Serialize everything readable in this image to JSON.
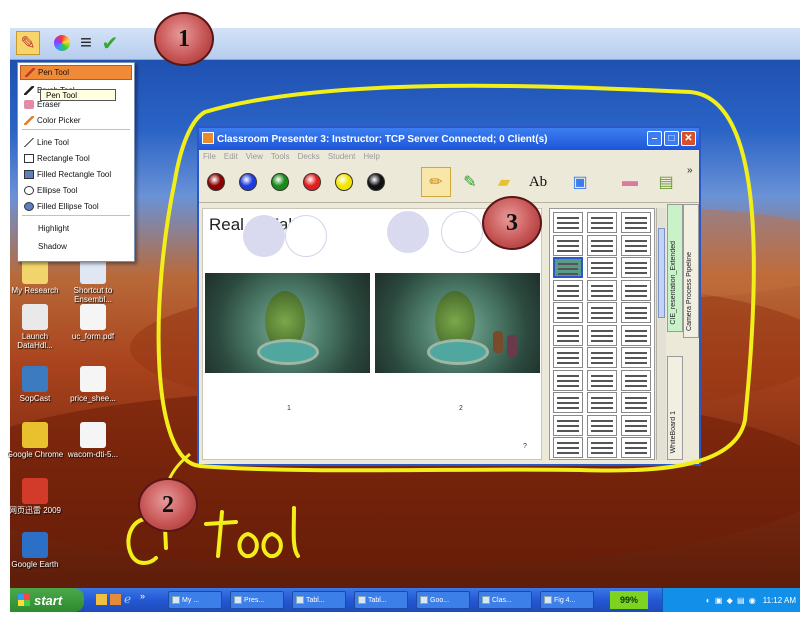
{
  "ink_toolbar": {
    "buttons": [
      {
        "icon": "pen-icon",
        "active": true
      },
      {
        "icon": "color-wheel-icon",
        "active": false
      },
      {
        "icon": "line-weight-icon",
        "active": false
      },
      {
        "icon": "checkmark-icon",
        "active": false
      }
    ]
  },
  "tool_menu": {
    "items": [
      {
        "label": "Pen Tool",
        "selected": true,
        "icon": "pen-icon"
      },
      {
        "label": "Brush Tool",
        "selected": false,
        "icon": "brush-icon"
      },
      {
        "label": "Eraser",
        "selected": false,
        "icon": "eraser-icon"
      },
      {
        "label": "Color Picker",
        "selected": false,
        "icon": "color-picker-icon"
      },
      {
        "label": "Line Tool",
        "selected": false,
        "icon": "line-icon"
      },
      {
        "label": "Rectangle Tool",
        "selected": false,
        "icon": "rectangle-icon"
      },
      {
        "label": "Filled Rectangle Tool",
        "selected": false,
        "icon": "filled-rectangle-icon"
      },
      {
        "label": "Ellipse Tool",
        "selected": false,
        "icon": "ellipse-icon"
      },
      {
        "label": "Filled Ellipse Tool",
        "selected": false,
        "icon": "filled-ellipse-icon"
      },
      {
        "label": "Highlight",
        "selected": false,
        "icon": ""
      },
      {
        "label": "Shadow",
        "selected": false,
        "icon": ""
      }
    ],
    "tooltip": "Pen Tool"
  },
  "desktop_icons": [
    {
      "label": "My Research",
      "icon": "folder-icon"
    },
    {
      "label": "Shortcut to Ensembl...",
      "icon": "shortcut-icon"
    },
    {
      "label": "Launch DataHdl...",
      "icon": "doc-icon"
    },
    {
      "label": "uc_form.pdf",
      "icon": "pdf-icon"
    },
    {
      "label": "SopCast",
      "icon": "sopcast-icon"
    },
    {
      "label": "price_shee...",
      "icon": "pdf-icon"
    },
    {
      "label": "Google Chrome",
      "icon": "chrome-icon"
    },
    {
      "label": "wacom-dti-5...",
      "icon": "pdf-icon"
    },
    {
      "label": "网页迅雷 2009",
      "icon": "thunder-icon"
    },
    {
      "label": "Google Earth",
      "icon": "earth-icon"
    }
  ],
  "cp_window": {
    "title": "Classroom Presenter 3: Instructor; TCP Server Connected; 0 Client(s)",
    "menu": [
      "File",
      "Edit",
      "View",
      "Tools",
      "Decks",
      "Student",
      "Help"
    ],
    "pen_colors": [
      "#8b0000",
      "#1e3cdc",
      "#1a8a1a",
      "#e01e1e",
      "#f2e600",
      "#111111"
    ],
    "text_tool_label": "Ab",
    "overflow_label": "»",
    "slide": {
      "title": "Real or Fake?",
      "labels": [
        "1",
        "2"
      ],
      "corner_mark": "?"
    },
    "deck_tabs": [
      "CIE_resentation_Extended",
      "Camera Process Pipeline",
      "WhiteBoard 1"
    ]
  },
  "callouts": [
    "1",
    "2",
    "3"
  ],
  "handwriting": "CP tool",
  "taskbar": {
    "start_label": "start",
    "quick_launch_overflow": "»",
    "tasks": [
      "My ...",
      "Pres...",
      "Tabl...",
      "Tabl...",
      "Goo...",
      "Clas...",
      "Fig 4..."
    ],
    "battery": "99%",
    "clock": "11:12 AM"
  },
  "colors": {
    "annotation_ink": "#f2ee1a",
    "callout_fill": "#c75555",
    "selected_menu": "#f08a36",
    "title_bar": "#1e55d8"
  }
}
